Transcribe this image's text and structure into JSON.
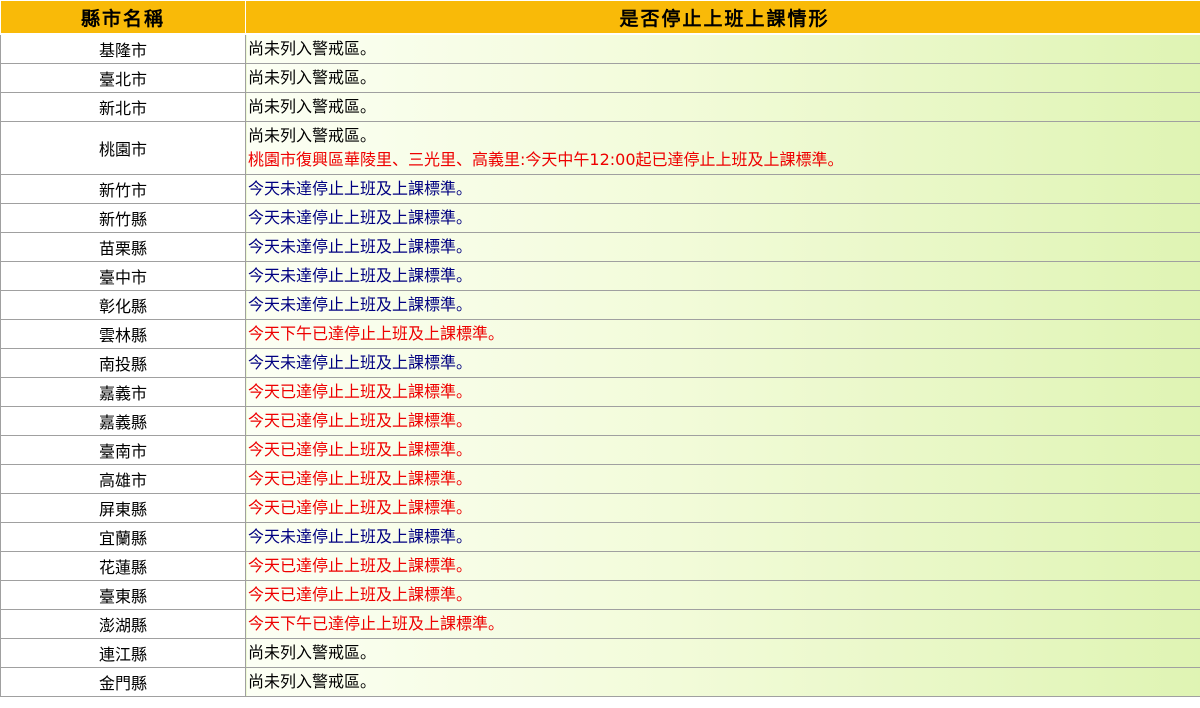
{
  "header": {
    "col_name": "縣市名稱",
    "col_status": "是否停止上班上課情形"
  },
  "colors": {
    "header_bg": "#f9ba08",
    "not_reached": "#000080",
    "reached": "#ee0000",
    "no_warning": "#000000"
  },
  "rows": [
    {
      "name": "基隆市",
      "lines": [
        {
          "text": "尚未列入警戒區。",
          "type": "none"
        }
      ]
    },
    {
      "name": "臺北市",
      "lines": [
        {
          "text": "尚未列入警戒區。",
          "type": "none"
        }
      ]
    },
    {
      "name": "新北市",
      "lines": [
        {
          "text": "尚未列入警戒區。",
          "type": "none"
        }
      ]
    },
    {
      "name": "桃園市",
      "lines": [
        {
          "text": "尚未列入警戒區。",
          "type": "none"
        },
        {
          "text": "桃園市復興區華陵里、三光里、高義里:今天中午12:00起已達停止上班及上課標準。",
          "type": "yes"
        }
      ]
    },
    {
      "name": "新竹市",
      "lines": [
        {
          "text": "今天未達停止上班及上課標準。",
          "type": "not"
        }
      ]
    },
    {
      "name": "新竹縣",
      "lines": [
        {
          "text": "今天未達停止上班及上課標準。",
          "type": "not"
        }
      ]
    },
    {
      "name": "苗栗縣",
      "lines": [
        {
          "text": "今天未達停止上班及上課標準。",
          "type": "not"
        }
      ]
    },
    {
      "name": "臺中市",
      "lines": [
        {
          "text": "今天未達停止上班及上課標準。",
          "type": "not"
        }
      ]
    },
    {
      "name": "彰化縣",
      "lines": [
        {
          "text": "今天未達停止上班及上課標準。",
          "type": "not"
        }
      ]
    },
    {
      "name": "雲林縣",
      "lines": [
        {
          "text": "今天下午已達停止上班及上課標準。",
          "type": "yes"
        }
      ]
    },
    {
      "name": "南投縣",
      "lines": [
        {
          "text": "今天未達停止上班及上課標準。",
          "type": "not"
        }
      ]
    },
    {
      "name": "嘉義市",
      "lines": [
        {
          "text": "今天已達停止上班及上課標準。",
          "type": "yes"
        }
      ]
    },
    {
      "name": "嘉義縣",
      "lines": [
        {
          "text": "今天已達停止上班及上課標準。",
          "type": "yes"
        }
      ]
    },
    {
      "name": "臺南市",
      "lines": [
        {
          "text": "今天已達停止上班及上課標準。",
          "type": "yes"
        }
      ]
    },
    {
      "name": "高雄市",
      "lines": [
        {
          "text": "今天已達停止上班及上課標準。",
          "type": "yes"
        }
      ]
    },
    {
      "name": "屏東縣",
      "lines": [
        {
          "text": "今天已達停止上班及上課標準。",
          "type": "yes"
        }
      ]
    },
    {
      "name": "宜蘭縣",
      "lines": [
        {
          "text": "今天未達停止上班及上課標準。",
          "type": "not"
        }
      ]
    },
    {
      "name": "花蓮縣",
      "lines": [
        {
          "text": "今天已達停止上班及上課標準。",
          "type": "yes"
        }
      ]
    },
    {
      "name": "臺東縣",
      "lines": [
        {
          "text": "今天已達停止上班及上課標準。",
          "type": "yes"
        }
      ]
    },
    {
      "name": "澎湖縣",
      "lines": [
        {
          "text": "今天下午已達停止上班及上課標準。",
          "type": "yes"
        }
      ]
    },
    {
      "name": "連江縣",
      "lines": [
        {
          "text": "尚未列入警戒區。",
          "type": "none"
        }
      ]
    },
    {
      "name": "金門縣",
      "lines": [
        {
          "text": "尚未列入警戒區。",
          "type": "none"
        }
      ]
    }
  ]
}
